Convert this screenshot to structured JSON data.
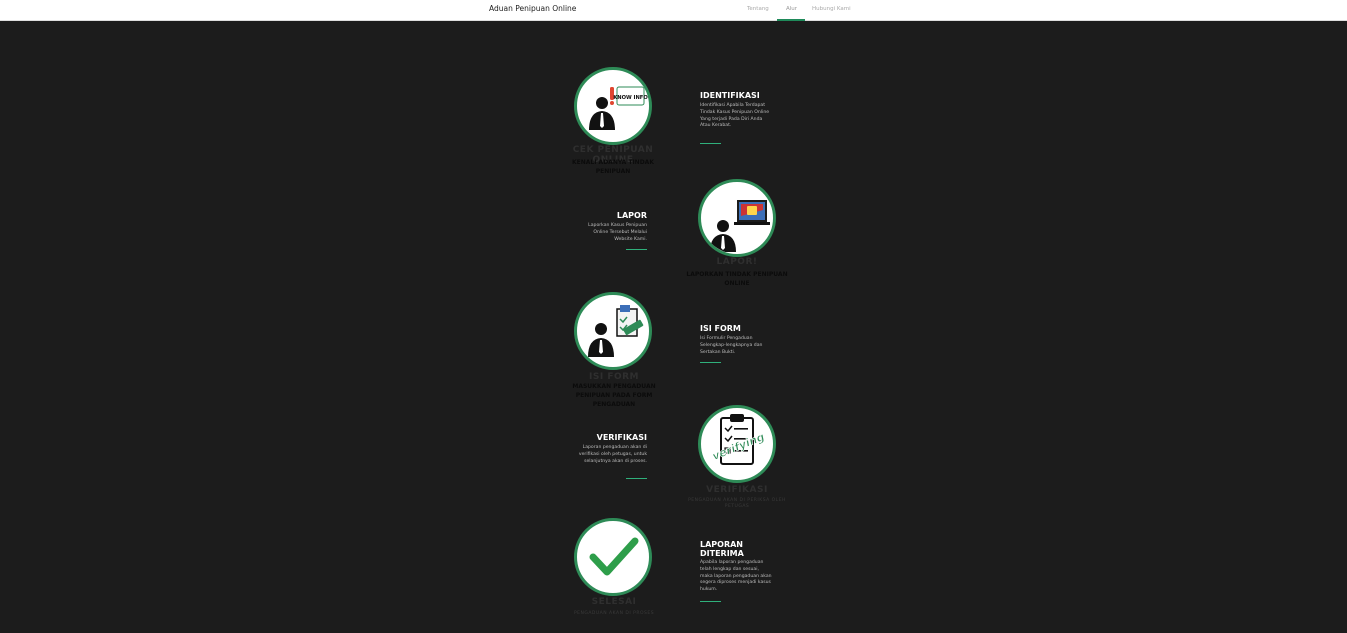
{
  "navbar": {
    "brand": "Aduan Penipuan Online",
    "links": [
      {
        "label": "Tentang",
        "active": false
      },
      {
        "label": "Alur",
        "active": true
      },
      {
        "label": "Hubungi Kami",
        "active": false
      }
    ]
  },
  "steps": [
    {
      "title": "IDENTIFIKASI",
      "description": "Identifikasi Apabila Terdapat Tindak Kasus Penipuan Online Yang terjadi Pada Diri Anda Atau Kerabat.",
      "image_caption_title": "CEK PENIPUAN ONLINE",
      "image_caption_sub": "KENALI ADANYA TINDAK PENIPUAN",
      "badge": "KNOW INFO",
      "icon": "person-alert-icon"
    },
    {
      "title": "LAPOR",
      "description": "Laporkan Kasus Penipuan Online Tersebut Melalui Website Kami.",
      "image_caption_title": "LAPOR!",
      "image_caption_sub": "LAPORKAN TINDAK PENIPUAN ONLINE",
      "icon": "person-laptop-icon"
    },
    {
      "title": "ISI FORM",
      "description": "Isi Formulir Pengaduan Selengkap-lengkapnya dan Sertakan Bukti.",
      "image_caption_title": "ISI FORM",
      "image_caption_sub": "MASUKKAN PENGADUAN PENIPUAN PADA FORM PENGADUAN",
      "icon": "person-form-icon"
    },
    {
      "title": "VERIFIKASI",
      "description": "Laporan pengaduan akan di verifikasi oleh petugas, untuk selanjutnya akan di proses.",
      "image_caption_title": "VERIFIKASI",
      "image_caption_sub": "PENGADUAN AKAN DI PERIKSA OLEH PETUGAS",
      "stamp": "verifying",
      "icon": "clipboard-verify-icon"
    },
    {
      "title": "LAPORAN DITERIMA",
      "description": "Apabila laporan pengaduan telah lengkap dan sesuai, maka laporan pengaduan akan segera diproses menjadi kasus hukum.",
      "image_caption_title": "SELESAI",
      "image_caption_sub": "PENGADUAN AKAN DI PROSES",
      "icon": "checkmark-icon"
    }
  ],
  "colors": {
    "accent": "#2e8b57",
    "line": "#2fb07b",
    "background": "#1c1c1c"
  }
}
